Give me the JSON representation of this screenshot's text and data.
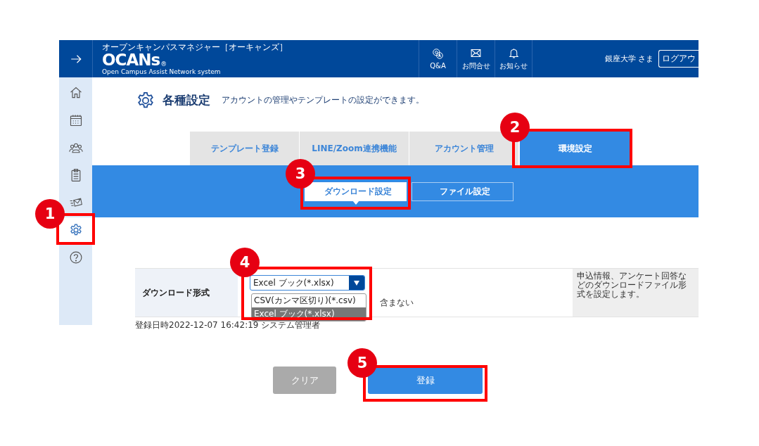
{
  "header": {
    "tagline": "オープンキャンパスマネジャー［オーキャンズ］",
    "logo": "OCANs",
    "registered": "®",
    "subtitle": "Open Campus Assist Network system",
    "user": "銀座大学 さま",
    "logout": "ログアウ"
  },
  "header_links": [
    {
      "kind": "qa",
      "label": "Q&A"
    },
    {
      "kind": "mail",
      "label": "お問合せ"
    },
    {
      "kind": "bell",
      "label": "お知らせ"
    }
  ],
  "sidebar": [
    {
      "kind": "home",
      "selected": false
    },
    {
      "kind": "calendar",
      "selected": false
    },
    {
      "kind": "people",
      "selected": false
    },
    {
      "kind": "clipboard",
      "selected": false
    },
    {
      "kind": "send",
      "selected": false
    },
    {
      "kind": "gear",
      "selected": true
    },
    {
      "kind": "help",
      "selected": false
    }
  ],
  "page": {
    "title": "各種設定",
    "description": "アカウントの管理やテンプレートの設定ができます。"
  },
  "tabs": [
    {
      "label": "テンプレート登録",
      "selected": false
    },
    {
      "label": "LINE/Zoom連携機能",
      "selected": false
    },
    {
      "label": "アカウント管理",
      "selected": false
    },
    {
      "label": "環境設定",
      "selected": true
    }
  ],
  "subtabs": [
    {
      "label": "ダウンロード設定",
      "selected": true
    },
    {
      "label": "ファイル設定",
      "selected": false
    }
  ],
  "settings": [
    {
      "label": "ダウンロード形式",
      "value": "Excel ブック(*.xlsx)",
      "options": [
        {
          "label": "CSV(カンマ区切り)(*.csv)",
          "selected": false
        },
        {
          "label": "Excel ブック(*.xlsx)",
          "selected": true
        }
      ],
      "covered_text": "含まない",
      "note": "申込情報、アンケート回答などのダウンロードファイル形式を設定します。"
    }
  ],
  "updated": "登録日時2022-12-07 16:42:19 システム管理者",
  "buttons": [
    {
      "kind": "secondary",
      "label": "クリア"
    },
    {
      "kind": "primary",
      "label": "登録"
    }
  ],
  "callouts": [
    "1",
    "2",
    "3",
    "4",
    "5"
  ]
}
